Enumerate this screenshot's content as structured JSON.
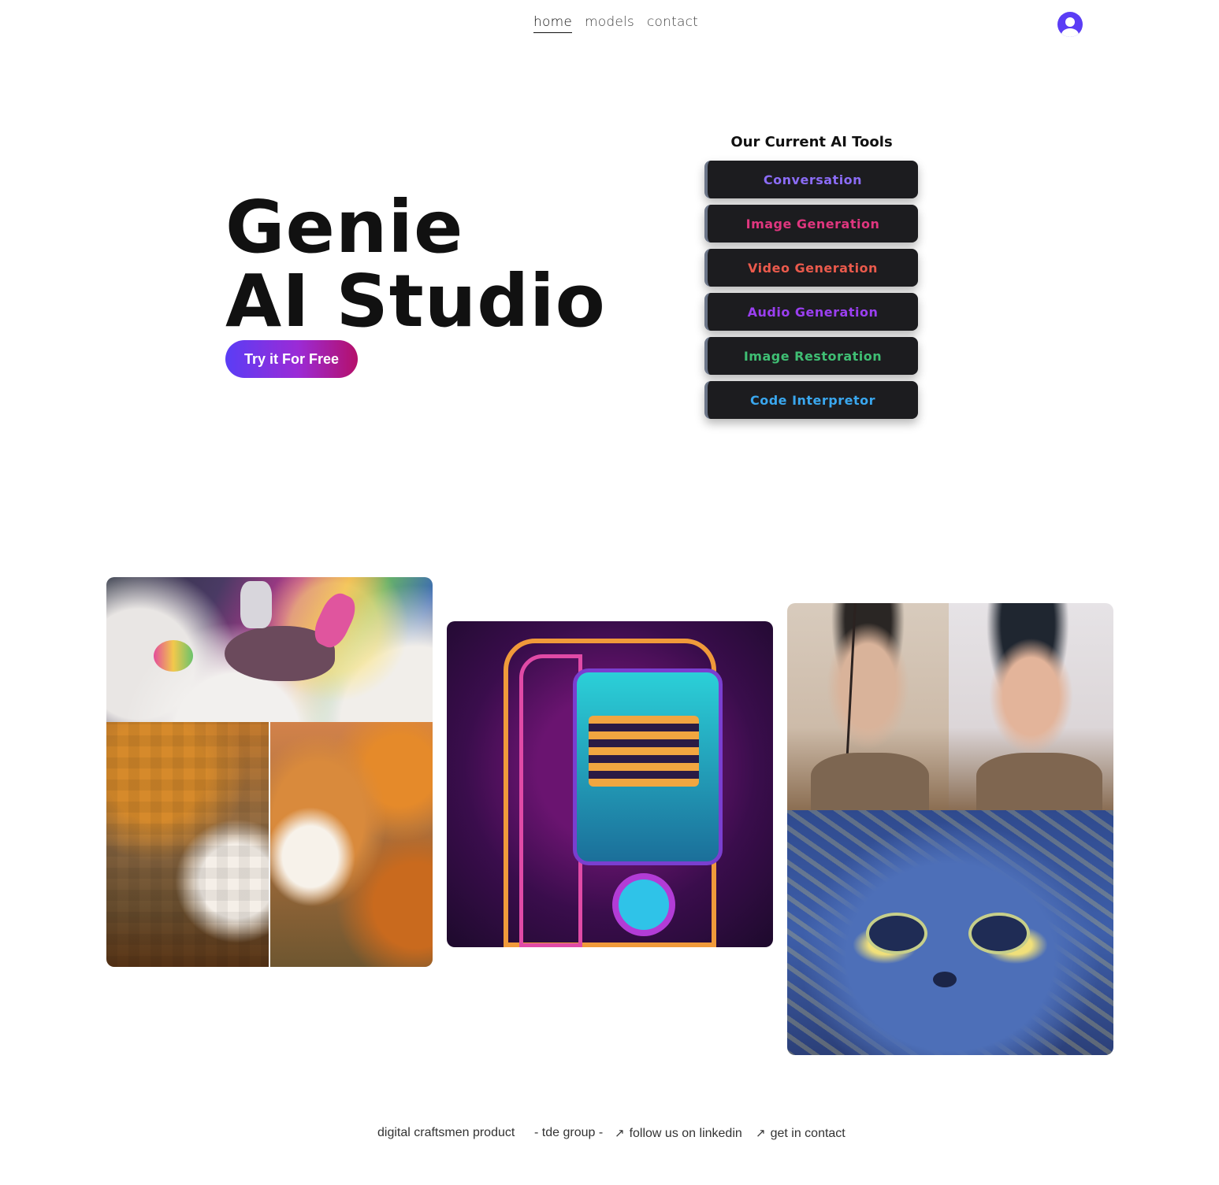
{
  "nav": {
    "links": [
      {
        "label": "home",
        "active": true
      },
      {
        "label": "models",
        "active": false
      },
      {
        "label": "contact",
        "active": false
      }
    ],
    "avatar_icon": "user-avatar-icon",
    "avatar_color": "#5b3df5"
  },
  "hero": {
    "title_line1": "Genie",
    "title_line2": "AI Studio",
    "cta_label": "Try it For Free",
    "cta_gradient": [
      "#5a3df5",
      "#9b2bd6",
      "#b5106a"
    ]
  },
  "tools": {
    "heading": "Our Current AI Tools",
    "items": [
      {
        "label": "Conversation",
        "color": "#8b6cf6"
      },
      {
        "label": "Image Generation",
        "color": "#e0367f"
      },
      {
        "label": "Video Generation",
        "color": "#ea5a4c"
      },
      {
        "label": "Audio Generation",
        "color": "#9a3ff0"
      },
      {
        "label": "Image Restoration",
        "color": "#3fbe73"
      },
      {
        "label": "Code Interpretor",
        "color": "#3aa7ee"
      }
    ]
  },
  "gallery": {
    "images": [
      "astronaut-on-unicorn-image",
      "pixelated-shiba-comparison-image",
      "neon-arcade-machine-image",
      "restored-portrait-comparison-image",
      "starry-night-cat-image"
    ]
  },
  "footer": {
    "brand": "digital craftsmen product",
    "group": "- tde group -",
    "linkedin": "follow us on linkedin",
    "contact": "get in contact",
    "link_icon": "external-arrow-icon"
  }
}
